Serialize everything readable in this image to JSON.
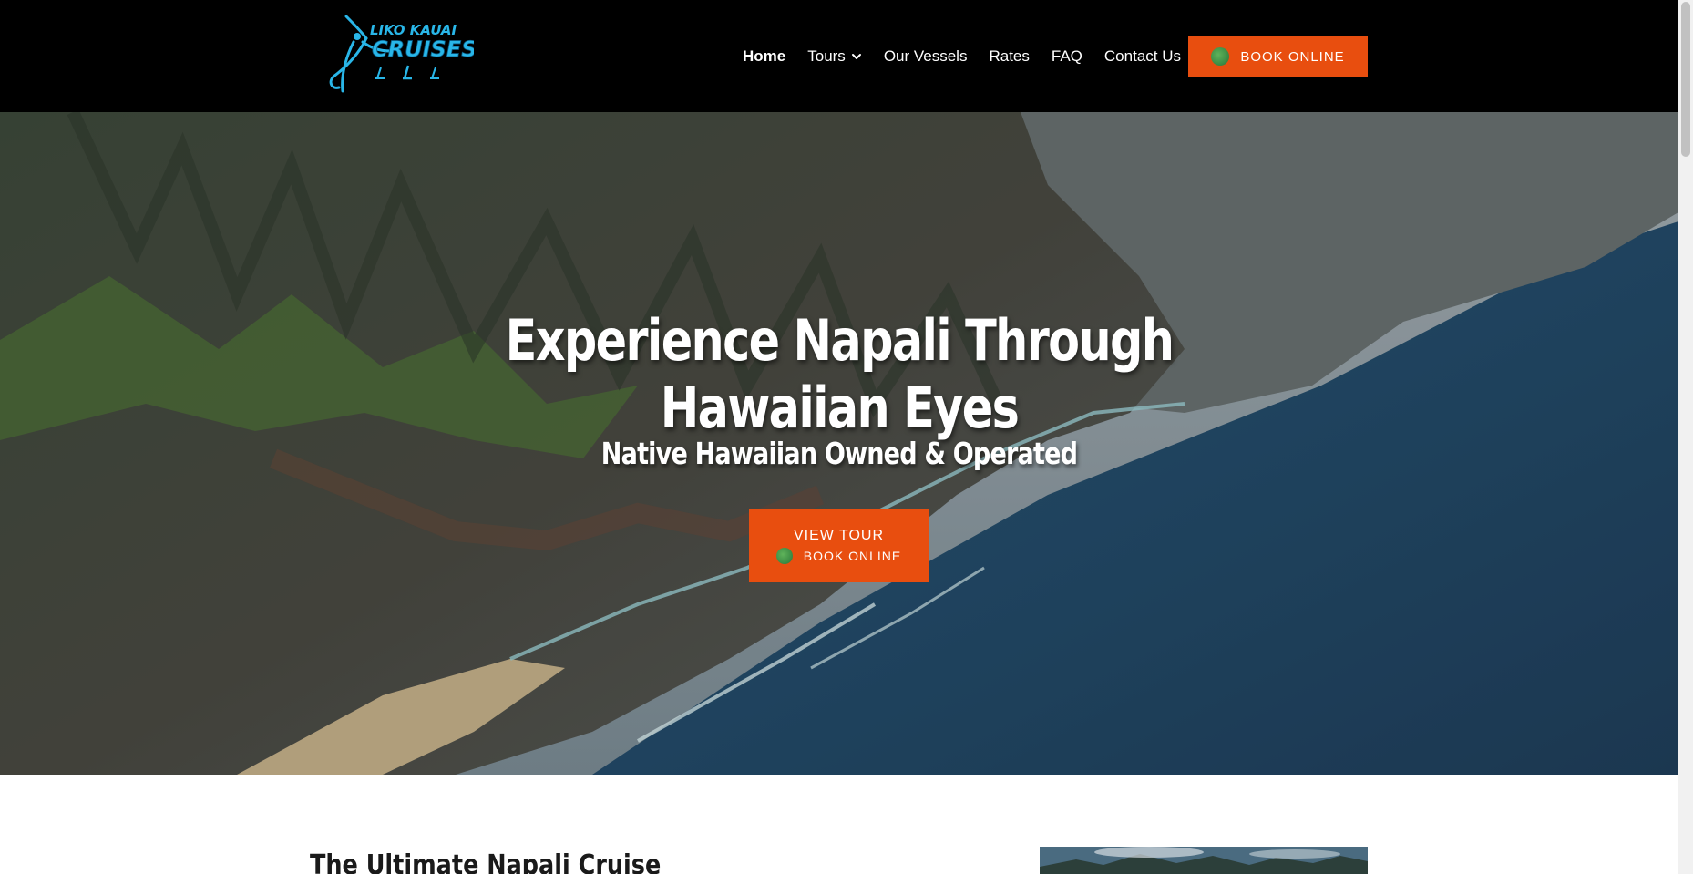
{
  "brand": {
    "logo_alt": "Liko Kauai Cruises",
    "logo_line1": "LIKO KAUAI",
    "logo_line2": "CRUISES",
    "logo_color": "#29b6e8"
  },
  "nav": {
    "items": [
      {
        "label": "Home",
        "active": true
      },
      {
        "label": "Tours",
        "has_dropdown": true
      },
      {
        "label": "Our Vessels"
      },
      {
        "label": "Rates"
      },
      {
        "label": "FAQ"
      },
      {
        "label": "Contact Us"
      }
    ],
    "book_button": {
      "label": "BOOK ONLINE",
      "icon": "globe-icon"
    }
  },
  "hero": {
    "title": "Experience Napali Through Hawaiian Eyes",
    "subtitle": "Native Hawaiian Owned & Operated",
    "cta_top": "VIEW TOUR",
    "cta_bottom": "BOOK ONLINE"
  },
  "content": {
    "section_title": "The Ultimate Napali Cruise"
  },
  "colors": {
    "header_bg": "#000000",
    "accent": "#e84e0f",
    "text_light": "#ffffff",
    "brand_blue": "#29b6e8"
  }
}
